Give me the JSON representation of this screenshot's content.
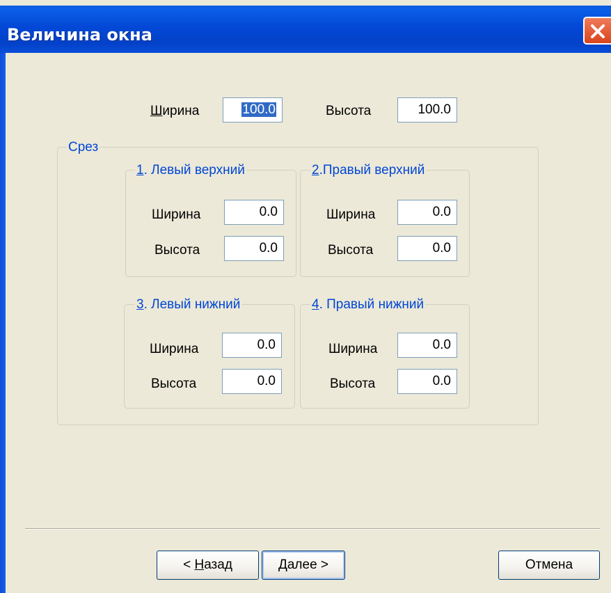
{
  "window": {
    "title": "Величина окна"
  },
  "size": {
    "width_label": "Ширина",
    "width_value": "100.0",
    "height_label": "Высота",
    "height_value": "100.0"
  },
  "cut": {
    "group_label": "Срез",
    "corners": [
      {
        "number": "1",
        "title": ". Левый верхний",
        "width_label": "Ширина",
        "width_value": "0.0",
        "height_label": "Высота",
        "height_value": "0.0"
      },
      {
        "number": "2",
        "title": ".Правый верхний",
        "width_label": "Ширина",
        "width_value": "0.0",
        "height_label": "Высота",
        "height_value": "0.0"
      },
      {
        "number": "3",
        "title": ". Левый нижний",
        "width_label": "Ширина",
        "width_value": "0.0",
        "height_label": "Высота",
        "height_value": "0.0"
      },
      {
        "number": "4",
        "title": ". Правый нижний",
        "width_label": "Ширина",
        "width_value": "0.0",
        "height_label": "Высота",
        "height_value": "0.0"
      }
    ]
  },
  "buttons": {
    "back_prefix": "< ",
    "back_hotkey": "Н",
    "back_rest": "азад",
    "next_hotkey": "Д",
    "next_rest": "алее >",
    "cancel": "Отмена"
  },
  "colors": {
    "titlebar": "#0348d6",
    "dialog_bg": "#ece9d8",
    "group_title": "#0046d5",
    "close_button": "#d8451c",
    "selection": "#316ac5"
  },
  "icons": {
    "close": "close-icon"
  }
}
